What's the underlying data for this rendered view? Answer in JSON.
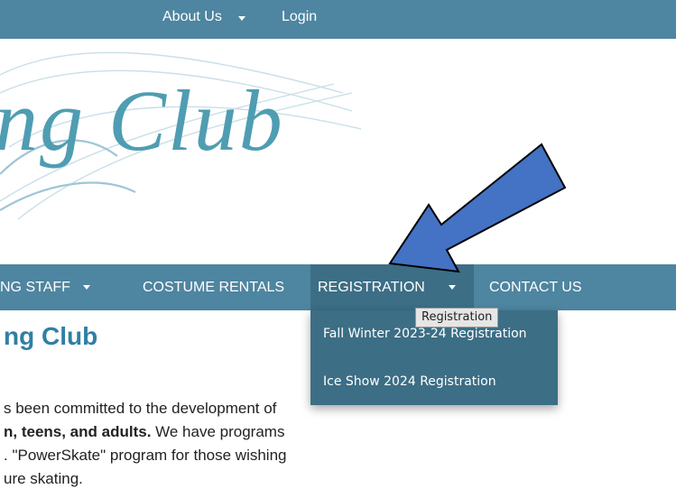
{
  "top_nav": {
    "about_label": "About Us",
    "login_label": "Login"
  },
  "logo": {
    "text": "ng Club"
  },
  "main_nav": {
    "items": [
      {
        "label": "NG STAFF"
      },
      {
        "label": "COSTUME RENTALS"
      },
      {
        "label": "REGISTRATION"
      },
      {
        "label": "CONTACT US"
      }
    ]
  },
  "dropdown": {
    "tooltip": "Registration",
    "items": [
      {
        "label": "Fall Winter 2023-24 Registration"
      },
      {
        "label": "Ice Show 2024 Registration"
      }
    ]
  },
  "content": {
    "heading": "ng Club",
    "line1": "s been committed to the development of",
    "line2_bold": "n, teens, and adults.",
    "line2_rest": " We have programs",
    "line3": ". \"PowerSkate\" program for those wishing",
    "line4": "ure skating."
  },
  "colors": {
    "nav_bar": "#4e85a0",
    "nav_active": "#3c6e85",
    "heading": "#2f7fa5",
    "logo_text": "#4f9db2",
    "annotation_arrow": "#4472c4"
  },
  "icons": {
    "dropdown_caret": "chevron-down-icon",
    "annotation": "pointer-arrow-icon"
  }
}
